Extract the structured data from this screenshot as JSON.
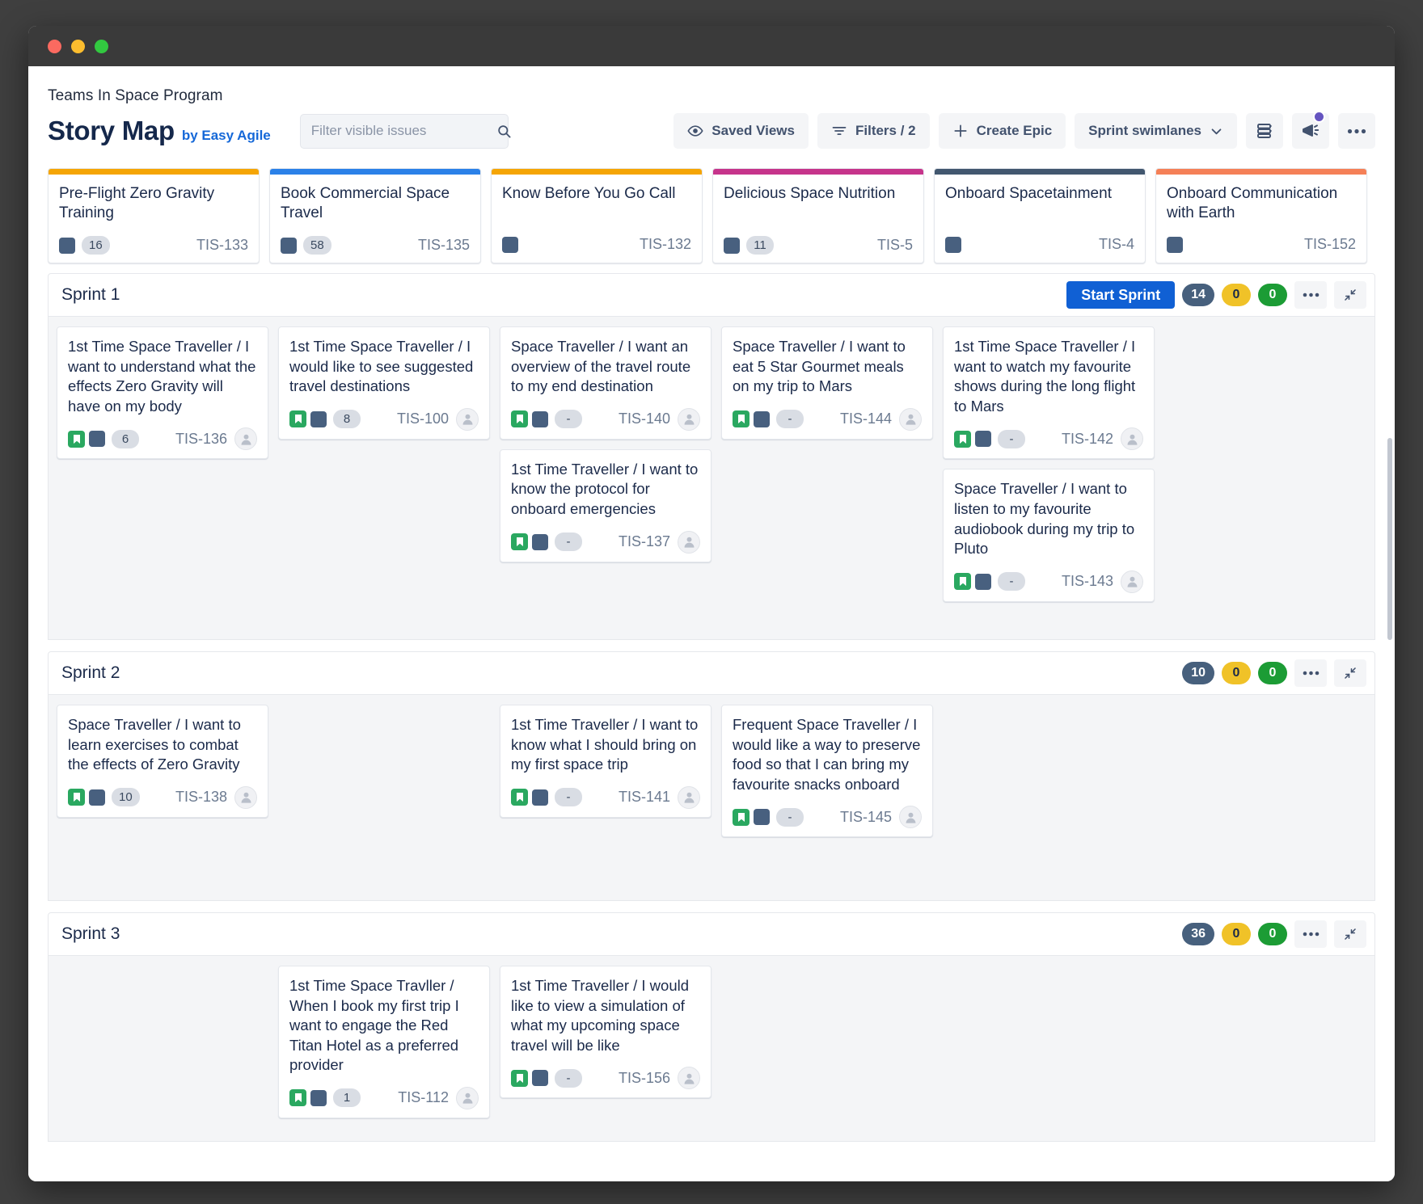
{
  "window": {
    "traffic_lights": [
      "close",
      "minimize",
      "maximize"
    ]
  },
  "header": {
    "breadcrumb": "Teams In Space Program",
    "title": "Story Map",
    "byline": "by Easy Agile",
    "search": {
      "placeholder": "Filter visible issues",
      "value": "",
      "icon": "search-icon"
    }
  },
  "toolbar": {
    "saved_views": {
      "label": "Saved Views",
      "icon": "eye-icon"
    },
    "filters": {
      "label": "Filters / 2",
      "icon": "filter-icon"
    },
    "create_epic": {
      "label": "Create Epic",
      "icon": "plus-icon"
    },
    "swimlanes": {
      "label": "Sprint swimlanes",
      "icon": "chevron-down-icon"
    },
    "layers": {
      "icon": "stacked-layers-icon"
    },
    "announcements": {
      "icon": "megaphone-icon",
      "has_notification": true,
      "dot_color": "#6554c0"
    },
    "more": {
      "icon": "more-horizontal-icon"
    }
  },
  "epics": [
    {
      "title": "Pre-Flight Zero Gravity Training",
      "count": "16",
      "key": "TIS-133",
      "color": "#f5a505"
    },
    {
      "title": "Book Commercial Space Travel",
      "count": "58",
      "key": "TIS-135",
      "color": "#2b81e8"
    },
    {
      "title": "Know Before You Go Call",
      "count": "",
      "key": "TIS-132",
      "color": "#f5a505"
    },
    {
      "title": "Delicious Space Nutrition",
      "count": "11",
      "key": "TIS-5",
      "color": "#c6348b"
    },
    {
      "title": "Onboard Spacetainment",
      "count": "",
      "key": "TIS-4",
      "color": "#42576f"
    },
    {
      "title": "Onboard Communication with Earth",
      "count": "",
      "key": "TIS-152",
      "color": "#f58057"
    }
  ],
  "lanes": [
    {
      "name": "Sprint 1",
      "start_button": "Start Sprint",
      "badges": {
        "total": "14",
        "in_progress": "0",
        "done": "0"
      },
      "more_icon": "more-horizontal-icon",
      "collapse_icon": "collapse-icon",
      "columns": [
        [
          {
            "title": "1st Time Space Traveller / I want to understand what the effects Zero Gravity will have on my body",
            "points": "6",
            "key": "TIS-136"
          }
        ],
        [
          {
            "title": "1st Time Space Traveller / I would like to see suggested travel destinations",
            "points": "8",
            "key": "TIS-100"
          }
        ],
        [
          {
            "title": "Space Traveller / I want an overview of the travel route to my end destination",
            "points": "-",
            "key": "TIS-140"
          },
          {
            "title": "1st Time Traveller / I want to know the protocol for onboard emergencies",
            "points": "-",
            "key": "TIS-137"
          }
        ],
        [
          {
            "title": "Space Traveller / I want to eat 5 Star Gourmet meals on my trip to Mars",
            "points": "-",
            "key": "TIS-144"
          }
        ],
        [
          {
            "title": "1st Time Space Traveller / I want to watch my favourite shows during the long flight to Mars",
            "points": "-",
            "key": "TIS-142"
          },
          {
            "title": "Space Traveller / I want to listen to my favourite audiobook during my trip to Pluto",
            "points": "-",
            "key": "TIS-143"
          }
        ],
        []
      ]
    },
    {
      "name": "Sprint 2",
      "start_button": "",
      "badges": {
        "total": "10",
        "in_progress": "0",
        "done": "0"
      },
      "more_icon": "more-horizontal-icon",
      "collapse_icon": "collapse-icon",
      "columns": [
        [
          {
            "title": "Space Traveller / I want to learn exercises to combat the effects of Zero Gravity",
            "points": "10",
            "key": "TIS-138"
          }
        ],
        [],
        [
          {
            "title": "1st Time Traveller / I want to know what I should bring on my first space trip",
            "points": "-",
            "key": "TIS-141"
          }
        ],
        [
          {
            "title": "Frequent Space Traveller / I would like a way to preserve food so that I can bring my favourite snacks onboard",
            "points": "-",
            "key": "TIS-145"
          }
        ],
        [],
        []
      ]
    },
    {
      "name": "Sprint 3",
      "start_button": "",
      "badges": {
        "total": "36",
        "in_progress": "0",
        "done": "0"
      },
      "more_icon": "more-horizontal-icon",
      "collapse_icon": "collapse-icon",
      "columns": [
        [],
        [
          {
            "title": "1st Time Space Travller / When I book my first trip I want to engage the Red Titan Hotel as a preferred provider",
            "points": "1",
            "key": "TIS-112"
          }
        ],
        [
          {
            "title": "1st Time Traveller / I would like to view a simulation of what my upcoming space travel will be like",
            "points": "-",
            "key": "TIS-156"
          }
        ],
        [],
        [],
        []
      ]
    }
  ],
  "colors": {
    "primary_blue": "#1060d4",
    "link_blue": "#1568d8",
    "slate": "#47607d",
    "amber": "#f0c228",
    "green": "#1c9c35",
    "bookmark_green": "#2aa860",
    "text_dark": "#1b2a4a"
  }
}
